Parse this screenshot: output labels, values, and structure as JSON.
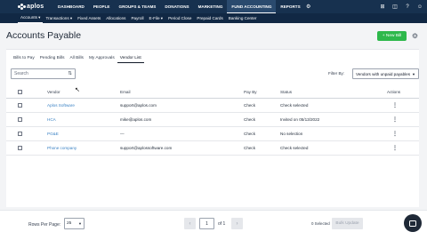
{
  "app": {
    "logo_text": "aplos"
  },
  "topnav": {
    "items": [
      "DASHBOARD",
      "PEOPLE",
      "GROUPS & TEAMS",
      "DONATIONS",
      "MARKETING",
      "FUND ACCOUNTING",
      "REPORTS"
    ],
    "active": "FUND ACCOUNTING"
  },
  "subnav": {
    "items": [
      "Accounts ▾",
      "Transactions ▾",
      "Fixed Assets",
      "Allocations",
      "Payroll",
      "E-File ▾",
      "Period Close",
      "Prepaid Cards",
      "Banking Center"
    ],
    "active": "Accounts ▾"
  },
  "page": {
    "title": "Accounts Payable",
    "new_bill_label": "+ New Bill"
  },
  "tabs": [
    "Bills to Pay",
    "Pending Bills",
    "All Bills",
    "My Approvals",
    "Vendor List"
  ],
  "active_tab": "Vendor List",
  "search": {
    "placeholder": "Search"
  },
  "filter": {
    "label": "Filter By:",
    "value": "Vendors with unpaid payables"
  },
  "table": {
    "headers": {
      "vendor": "Vendor",
      "email": "Email",
      "pay_by": "Pay By",
      "status": "Status",
      "actions": "Actions"
    },
    "rows": [
      {
        "vendor": "Aplos Software",
        "email": "support@aplos.com",
        "pay_by": "Check",
        "status": "Check selected"
      },
      {
        "vendor": "HCA",
        "email": "mike@aplos.com",
        "pay_by": "Check",
        "status": "Invited on 05/13/2022"
      },
      {
        "vendor": "PG&E",
        "email": "—",
        "pay_by": "Check",
        "status": "No selection"
      },
      {
        "vendor": "Phone company",
        "email": "support@aplossoftware.com",
        "pay_by": "Check",
        "status": "Check selected"
      }
    ]
  },
  "footer": {
    "rows_per_page_label": "Rows Per Page:",
    "rows_per_page_value": "25",
    "page_value": "1",
    "of_text": "of 1",
    "selected_text": "0 Selected",
    "bulk_update_label": "Bulk Update"
  },
  "colors": {
    "nav_bg": "#17314f",
    "accent_green": "#2eb84b",
    "link_blue": "#3b82c4"
  }
}
